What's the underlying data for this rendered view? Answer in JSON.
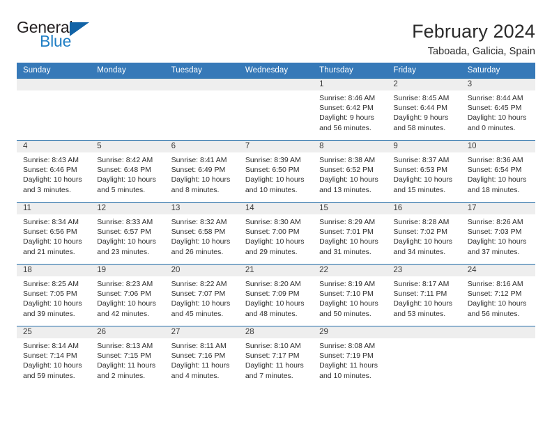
{
  "brand": {
    "name_top": "General",
    "name_bottom": "Blue",
    "triangle_color": "#1263a6",
    "blue_color": "#1f7ec4",
    "dark_color": "#231f20"
  },
  "header": {
    "title": "February 2024",
    "subtitle": "Taboada, Galicia, Spain"
  },
  "theme": {
    "header_bg": "#3679b8",
    "row_border": "#1d6aa8",
    "daynum_band_bg": "#eeeeee",
    "text": "#2e2e2e"
  },
  "weekday_headers": [
    "Sunday",
    "Monday",
    "Tuesday",
    "Wednesday",
    "Thursday",
    "Friday",
    "Saturday"
  ],
  "weeks": [
    [
      {
        "day": "",
        "lines": []
      },
      {
        "day": "",
        "lines": []
      },
      {
        "day": "",
        "lines": []
      },
      {
        "day": "",
        "lines": []
      },
      {
        "day": "1",
        "lines": [
          "Sunrise: 8:46 AM",
          "Sunset: 6:42 PM",
          "Daylight: 9 hours",
          "and 56 minutes."
        ]
      },
      {
        "day": "2",
        "lines": [
          "Sunrise: 8:45 AM",
          "Sunset: 6:44 PM",
          "Daylight: 9 hours",
          "and 58 minutes."
        ]
      },
      {
        "day": "3",
        "lines": [
          "Sunrise: 8:44 AM",
          "Sunset: 6:45 PM",
          "Daylight: 10 hours",
          "and 0 minutes."
        ]
      }
    ],
    [
      {
        "day": "4",
        "lines": [
          "Sunrise: 8:43 AM",
          "Sunset: 6:46 PM",
          "Daylight: 10 hours",
          "and 3 minutes."
        ]
      },
      {
        "day": "5",
        "lines": [
          "Sunrise: 8:42 AM",
          "Sunset: 6:48 PM",
          "Daylight: 10 hours",
          "and 5 minutes."
        ]
      },
      {
        "day": "6",
        "lines": [
          "Sunrise: 8:41 AM",
          "Sunset: 6:49 PM",
          "Daylight: 10 hours",
          "and 8 minutes."
        ]
      },
      {
        "day": "7",
        "lines": [
          "Sunrise: 8:39 AM",
          "Sunset: 6:50 PM",
          "Daylight: 10 hours",
          "and 10 minutes."
        ]
      },
      {
        "day": "8",
        "lines": [
          "Sunrise: 8:38 AM",
          "Sunset: 6:52 PM",
          "Daylight: 10 hours",
          "and 13 minutes."
        ]
      },
      {
        "day": "9",
        "lines": [
          "Sunrise: 8:37 AM",
          "Sunset: 6:53 PM",
          "Daylight: 10 hours",
          "and 15 minutes."
        ]
      },
      {
        "day": "10",
        "lines": [
          "Sunrise: 8:36 AM",
          "Sunset: 6:54 PM",
          "Daylight: 10 hours",
          "and 18 minutes."
        ]
      }
    ],
    [
      {
        "day": "11",
        "lines": [
          "Sunrise: 8:34 AM",
          "Sunset: 6:56 PM",
          "Daylight: 10 hours",
          "and 21 minutes."
        ]
      },
      {
        "day": "12",
        "lines": [
          "Sunrise: 8:33 AM",
          "Sunset: 6:57 PM",
          "Daylight: 10 hours",
          "and 23 minutes."
        ]
      },
      {
        "day": "13",
        "lines": [
          "Sunrise: 8:32 AM",
          "Sunset: 6:58 PM",
          "Daylight: 10 hours",
          "and 26 minutes."
        ]
      },
      {
        "day": "14",
        "lines": [
          "Sunrise: 8:30 AM",
          "Sunset: 7:00 PM",
          "Daylight: 10 hours",
          "and 29 minutes."
        ]
      },
      {
        "day": "15",
        "lines": [
          "Sunrise: 8:29 AM",
          "Sunset: 7:01 PM",
          "Daylight: 10 hours",
          "and 31 minutes."
        ]
      },
      {
        "day": "16",
        "lines": [
          "Sunrise: 8:28 AM",
          "Sunset: 7:02 PM",
          "Daylight: 10 hours",
          "and 34 minutes."
        ]
      },
      {
        "day": "17",
        "lines": [
          "Sunrise: 8:26 AM",
          "Sunset: 7:03 PM",
          "Daylight: 10 hours",
          "and 37 minutes."
        ]
      }
    ],
    [
      {
        "day": "18",
        "lines": [
          "Sunrise: 8:25 AM",
          "Sunset: 7:05 PM",
          "Daylight: 10 hours",
          "and 39 minutes."
        ]
      },
      {
        "day": "19",
        "lines": [
          "Sunrise: 8:23 AM",
          "Sunset: 7:06 PM",
          "Daylight: 10 hours",
          "and 42 minutes."
        ]
      },
      {
        "day": "20",
        "lines": [
          "Sunrise: 8:22 AM",
          "Sunset: 7:07 PM",
          "Daylight: 10 hours",
          "and 45 minutes."
        ]
      },
      {
        "day": "21",
        "lines": [
          "Sunrise: 8:20 AM",
          "Sunset: 7:09 PM",
          "Daylight: 10 hours",
          "and 48 minutes."
        ]
      },
      {
        "day": "22",
        "lines": [
          "Sunrise: 8:19 AM",
          "Sunset: 7:10 PM",
          "Daylight: 10 hours",
          "and 50 minutes."
        ]
      },
      {
        "day": "23",
        "lines": [
          "Sunrise: 8:17 AM",
          "Sunset: 7:11 PM",
          "Daylight: 10 hours",
          "and 53 minutes."
        ]
      },
      {
        "day": "24",
        "lines": [
          "Sunrise: 8:16 AM",
          "Sunset: 7:12 PM",
          "Daylight: 10 hours",
          "and 56 minutes."
        ]
      }
    ],
    [
      {
        "day": "25",
        "lines": [
          "Sunrise: 8:14 AM",
          "Sunset: 7:14 PM",
          "Daylight: 10 hours",
          "and 59 minutes."
        ]
      },
      {
        "day": "26",
        "lines": [
          "Sunrise: 8:13 AM",
          "Sunset: 7:15 PM",
          "Daylight: 11 hours",
          "and 2 minutes."
        ]
      },
      {
        "day": "27",
        "lines": [
          "Sunrise: 8:11 AM",
          "Sunset: 7:16 PM",
          "Daylight: 11 hours",
          "and 4 minutes."
        ]
      },
      {
        "day": "28",
        "lines": [
          "Sunrise: 8:10 AM",
          "Sunset: 7:17 PM",
          "Daylight: 11 hours",
          "and 7 minutes."
        ]
      },
      {
        "day": "29",
        "lines": [
          "Sunrise: 8:08 AM",
          "Sunset: 7:19 PM",
          "Daylight: 11 hours",
          "and 10 minutes."
        ]
      },
      {
        "day": "",
        "lines": []
      },
      {
        "day": "",
        "lines": []
      }
    ]
  ]
}
